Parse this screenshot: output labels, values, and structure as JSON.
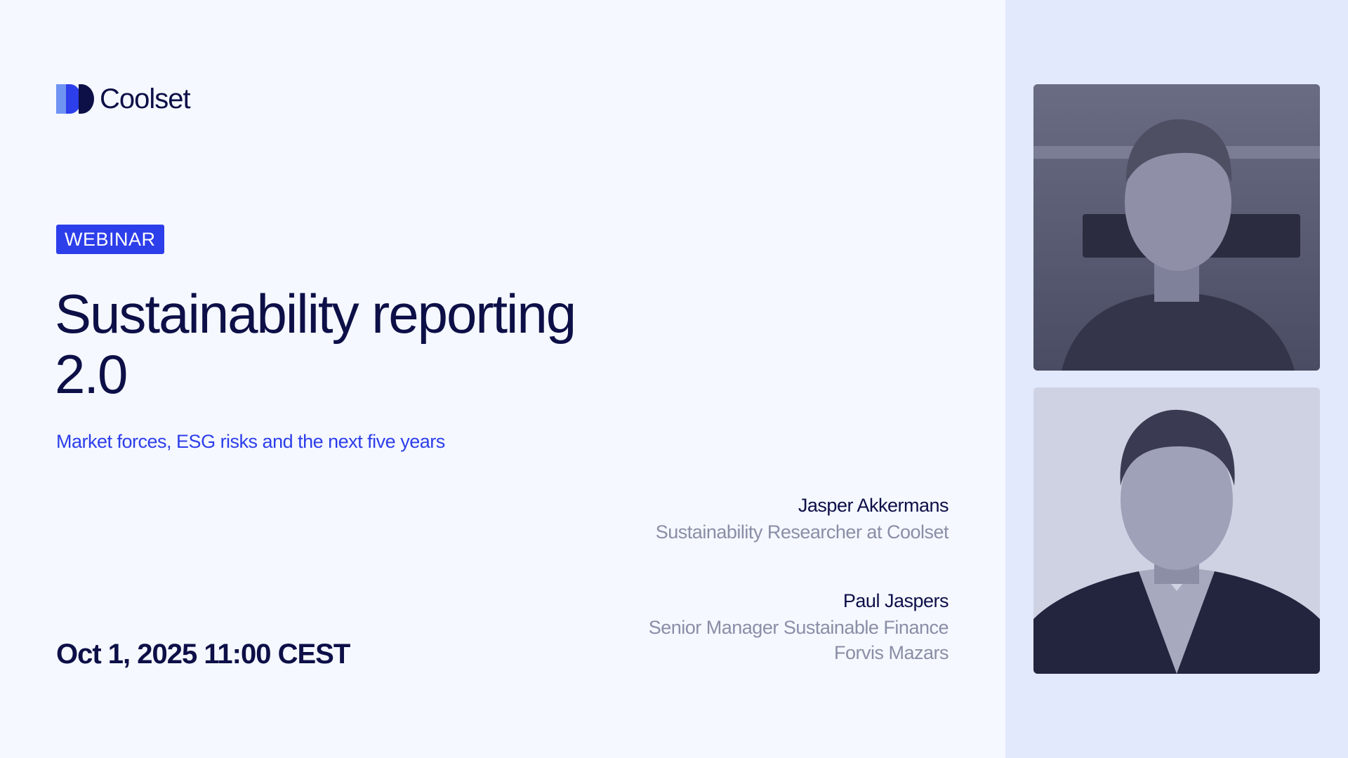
{
  "brand": {
    "name": "Coolset",
    "logo_icon": "coolset-logo-mark"
  },
  "event": {
    "badge": "WEBINAR",
    "title_line1": "Sustainability reporting",
    "title_line2": "2.0",
    "subtitle": "Market forces, ESG risks and the next five years",
    "datetime": "Oct 1, 2025 11:00 CEST"
  },
  "speakers": [
    {
      "name": "Jasper Akkermans",
      "role_line1": "Sustainability Researcher at Coolset",
      "photo_icon": "speaker-portrait-photo"
    },
    {
      "name": "Paul Jaspers",
      "role_line1": "Senior Manager Sustainable Finance",
      "role_line2": "Forvis Mazars",
      "photo_icon": "speaker-portrait-photo"
    }
  ],
  "colors": {
    "background": "#f5f8ff",
    "panel": "#e2e9fd",
    "navy": "#0d0f47",
    "accent_blue": "#2d3eeb",
    "muted_gray": "#8a8ea6"
  }
}
